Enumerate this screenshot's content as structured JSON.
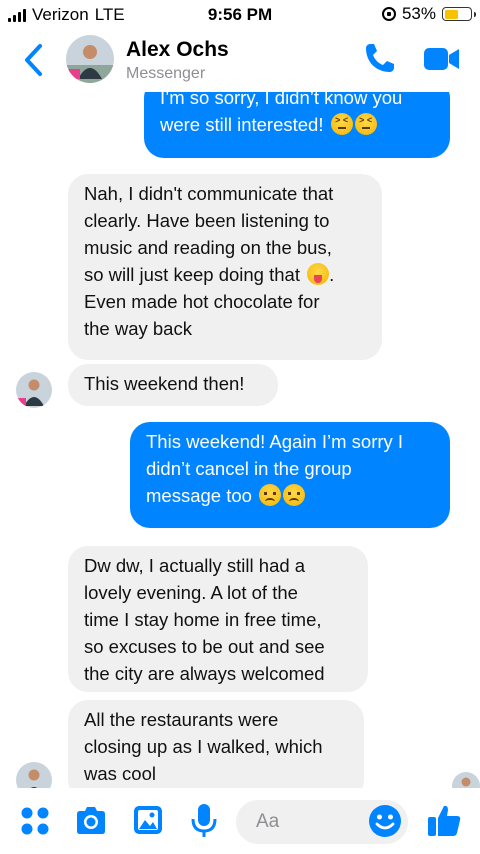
{
  "status_bar": {
    "carrier": "Verizon",
    "network": "LTE",
    "time": "9:56 PM",
    "battery": "53%",
    "battery_level": 0.53
  },
  "header": {
    "contact_name": "Alex Ochs",
    "subtitle": "Messenger"
  },
  "messages": [
    {
      "side": "out",
      "text": "I’m so sorry, I didn’t know you\nwere still interested! ",
      "emoji": [
        "confounded",
        "confounded"
      ]
    },
    {
      "side": "in",
      "text": "Nah, I didn't communicate that\nclearly. Have been listening to\nmusic and reading on the bus,\nso will just keep doing that ",
      "emoji": [
        "tongue"
      ],
      "after_emoji": ".\nEven made hot chocolate for\nthe way back"
    },
    {
      "side": "in",
      "text": "This weekend then!"
    },
    {
      "side": "out",
      "text": "This weekend! Again I’m sorry I\ndidn’t cancel in the group\nmessage too ",
      "emoji": [
        "disappointed",
        "disappointed"
      ]
    },
    {
      "side": "in",
      "text": "Dw dw, I actually still had a\nlovely evening. A lot of the\ntime I stay home in free time,\nso excuses to be out and see\nthe city are always welcomed"
    },
    {
      "side": "in",
      "text": "All the restaurants were\nclosing up as I walked, which\nwas cool"
    }
  ],
  "composer": {
    "placeholder": "Aa"
  },
  "colors": {
    "accent": "#0084ff",
    "incoming_bubble": "#f0f0f0",
    "battery_fill": "#f7c300"
  },
  "icons": {
    "back": "chevron-left-icon",
    "phone": "phone-icon",
    "video": "video-camera-icon",
    "more": "four-dots-icon",
    "camera": "camera-icon",
    "gallery": "image-icon",
    "mic": "microphone-icon",
    "emoji": "smiley-icon",
    "like": "thumbs-up-icon"
  }
}
